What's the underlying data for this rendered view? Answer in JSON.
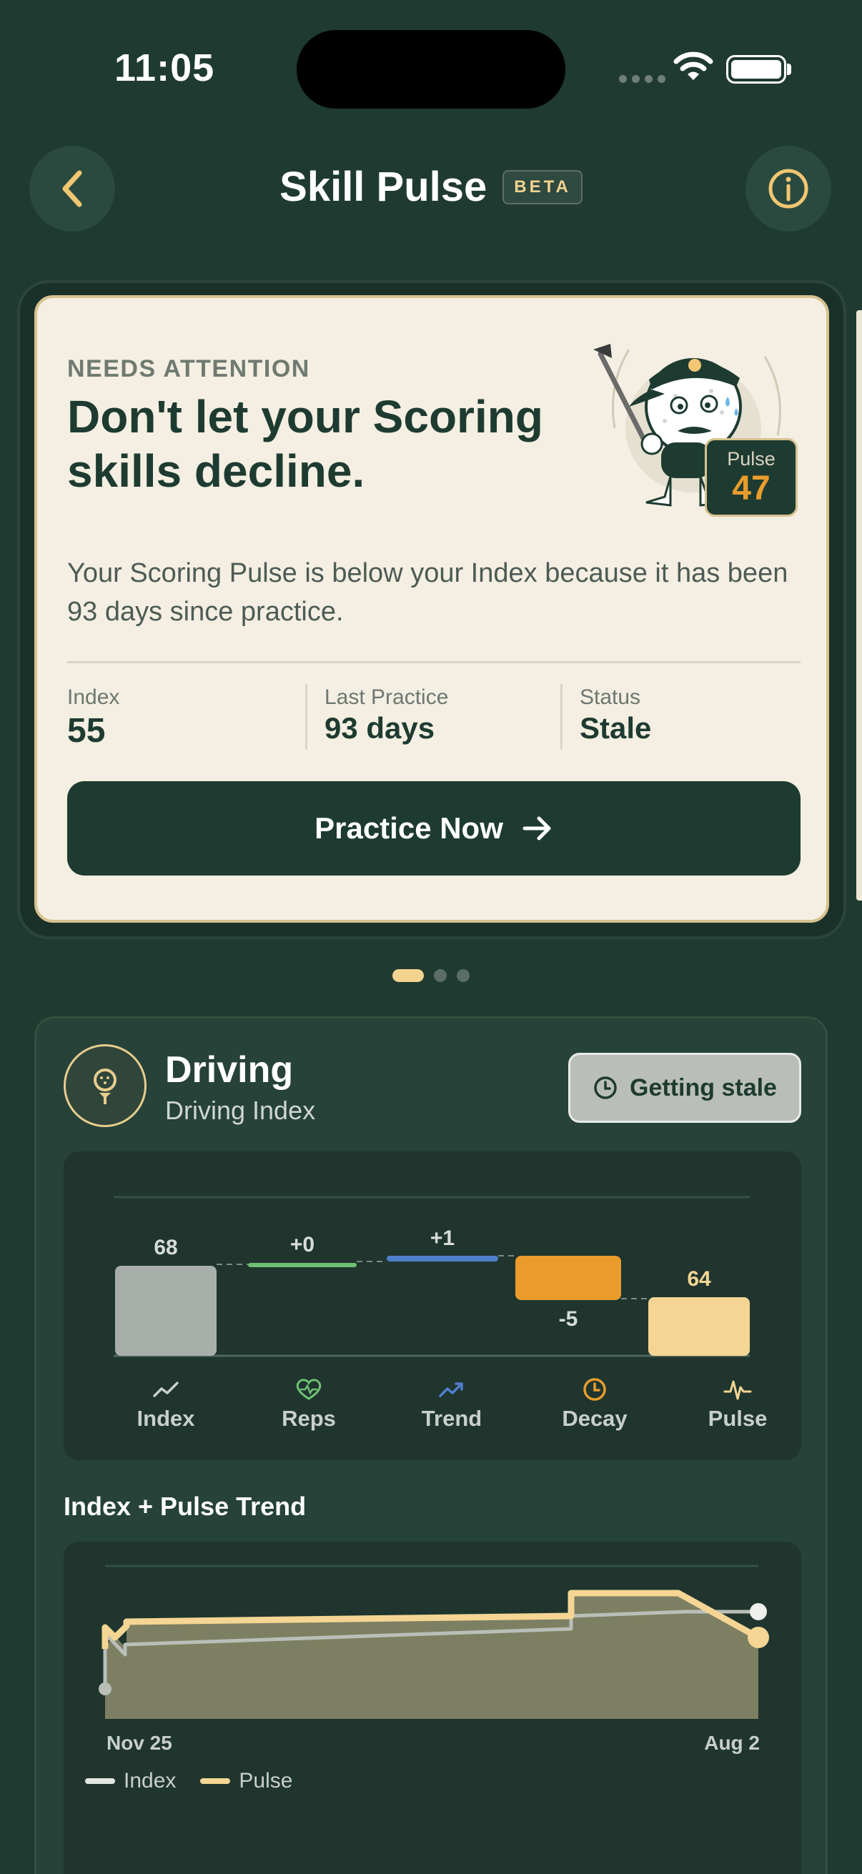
{
  "status_bar": {
    "time": "11:05"
  },
  "header": {
    "title": "Skill Pulse",
    "badge": "BETA"
  },
  "hero": {
    "eyebrow": "NEEDS ATTENTION",
    "headline": "Don't let your Scoring skills decline.",
    "pulse_label": "Pulse",
    "pulse_value": "47",
    "body": "Your Scoring Pulse is below your Index because it has been 93 days since practice.",
    "stats": [
      {
        "label": "Index",
        "value": "55"
      },
      {
        "label": "Last Practice",
        "value": "93 days"
      },
      {
        "label": "Status",
        "value": "Stale"
      }
    ],
    "cta": "Practice Now"
  },
  "pager": {
    "count": 3,
    "active": 0
  },
  "driving": {
    "title": "Driving",
    "subtitle": "Driving Index",
    "status_badge": "Getting stale",
    "waterfall": {
      "labels": [
        "Index",
        "Reps",
        "Trend",
        "Decay",
        "Pulse"
      ],
      "value_labels": [
        "68",
        "+0",
        "+1",
        "-5",
        "64"
      ],
      "colors": {
        "index": "#a8aea9",
        "reps": "#6fbf73",
        "trend": "#4f7fcb",
        "decay": "#e99c2c",
        "pulse": "#f4d593"
      }
    },
    "trend_title": "Index + Pulse Trend",
    "trend_start": "Nov 25",
    "trend_end": "Aug 2",
    "legend_index": "Index",
    "legend_pulse": "Pulse"
  },
  "chart_data": {
    "type": "line",
    "x": [
      "Nov 25",
      "Aug 2"
    ],
    "series": [
      {
        "name": "Index"
      },
      {
        "name": "Pulse"
      }
    ]
  }
}
